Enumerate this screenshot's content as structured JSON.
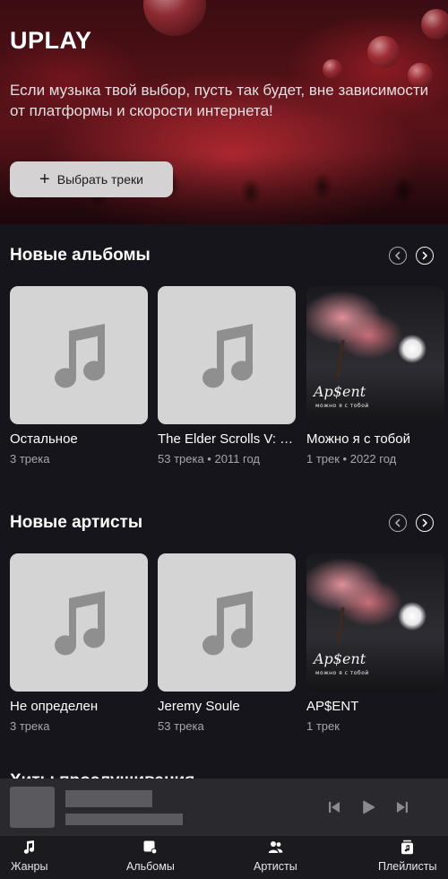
{
  "hero": {
    "title": "UPLAY",
    "subtitle": "Если музыка твой выбор, пусть так будет, вне зависимости от платформы и скорости интернета!",
    "button_label": "Выбрать треки",
    "button_icon": "plus-icon"
  },
  "albums": {
    "title": "Новые альбомы",
    "items": [
      {
        "title": "Остальное",
        "meta": "3 трека",
        "cover": "music-note-icon"
      },
      {
        "title": "The Elder Scrolls V: …",
        "meta": "53 трека • 2011 год",
        "cover": "music-note-icon"
      },
      {
        "title": "Можно я с тобой",
        "meta": "1 трек • 2022 год",
        "cover": "album-art"
      }
    ]
  },
  "artists": {
    "title": "Новые артисты",
    "items": [
      {
        "title": "Не определен",
        "meta": "3 трека",
        "cover": "music-note-icon"
      },
      {
        "title": "Jeremy Soule",
        "meta": "53 трека",
        "cover": "music-note-icon"
      },
      {
        "title": "AP$ENT",
        "meta": "1 трек",
        "cover": "album-art"
      }
    ]
  },
  "art_cover": {
    "text": "Ap$ent",
    "subtext": "можно я с тобой"
  },
  "next_section": {
    "title": "Хиты прослушивания"
  },
  "tabs": [
    {
      "label": "Жанры",
      "icon": "music-note-icon"
    },
    {
      "label": "Альбомы",
      "icon": "album-icon"
    },
    {
      "label": "Артисты",
      "icon": "users-icon"
    },
    {
      "label": "Плейлисты",
      "icon": "playlist-icon"
    }
  ],
  "colors": {
    "background": "#15151b",
    "button": "#d4d2d3",
    "player": "#29292e",
    "tabbar": "#1a1a1f"
  }
}
